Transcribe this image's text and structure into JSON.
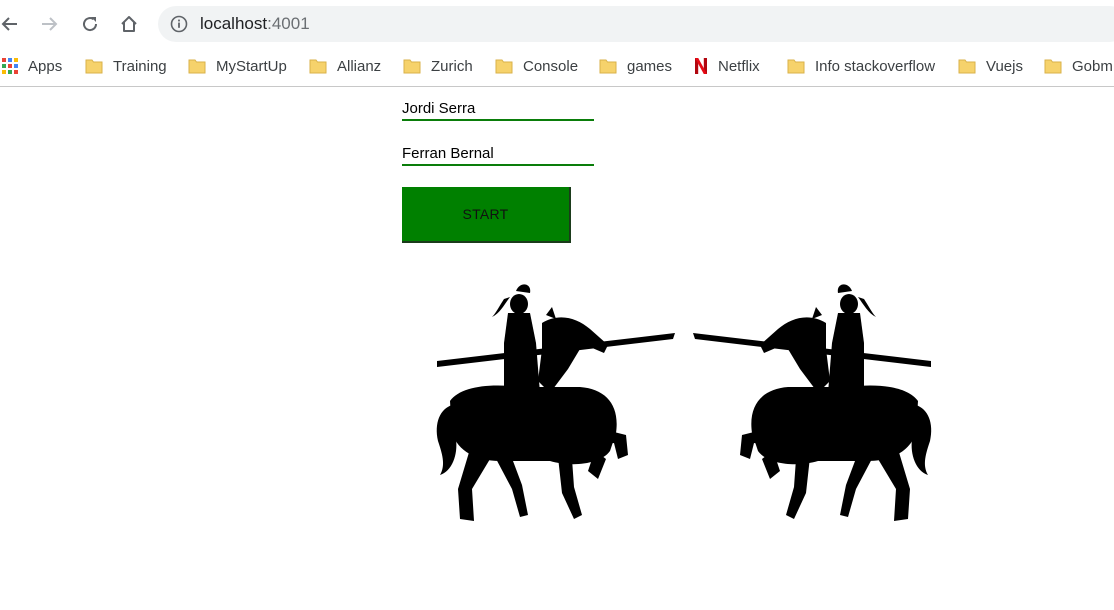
{
  "browser": {
    "url_host": "localhost",
    "url_port": ":4001",
    "nav_icons": [
      "back-arrow-icon",
      "forward-arrow-icon",
      "reload-icon",
      "home-icon",
      "info-icon"
    ]
  },
  "bookmarks": [
    {
      "label": "Apps",
      "icon": "apps-grid-icon"
    },
    {
      "label": "Training",
      "icon": "folder-icon"
    },
    {
      "label": "MyStartUp",
      "icon": "folder-icon"
    },
    {
      "label": "Allianz",
      "icon": "folder-icon"
    },
    {
      "label": "Zurich",
      "icon": "folder-icon"
    },
    {
      "label": "Console",
      "icon": "folder-icon"
    },
    {
      "label": "games",
      "icon": "folder-icon"
    },
    {
      "label": "Netflix",
      "icon": "netflix-icon"
    },
    {
      "label": "Info stackoverflow",
      "icon": "folder-icon"
    },
    {
      "label": "Vuejs",
      "icon": "folder-icon"
    },
    {
      "label": "Gobm",
      "icon": "folder-icon"
    }
  ],
  "form": {
    "player1": "Jordi Serra",
    "player2": "Ferran Bernal",
    "start_label": "START"
  },
  "colors": {
    "accent": "#008000",
    "underline": "#0a7d0a",
    "folder": "#f6d26b",
    "netflix": "#e50914"
  }
}
